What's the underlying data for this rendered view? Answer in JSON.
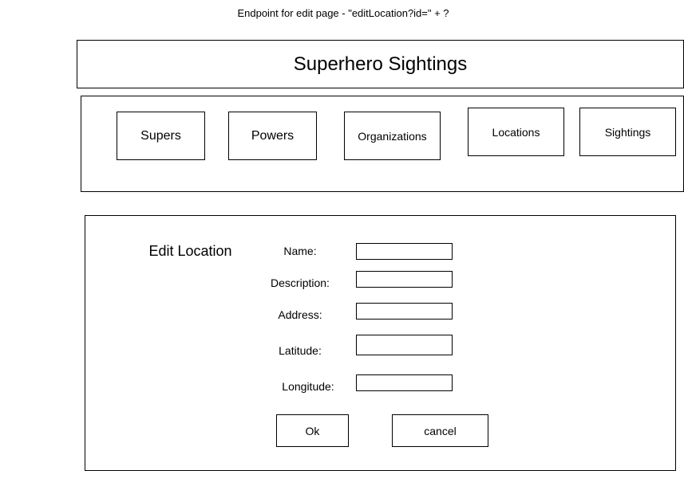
{
  "annotation": "Endpoint for  edit page - \"editLocation?id=\" + ?",
  "header": {
    "title": "Superhero Sightings"
  },
  "nav": {
    "items": [
      {
        "label": "Supers"
      },
      {
        "label": "Powers"
      },
      {
        "label": "Organizations"
      },
      {
        "label": "Locations"
      },
      {
        "label": "Sightings"
      }
    ]
  },
  "form": {
    "title": "Edit Location",
    "fields": [
      {
        "label": "Name:",
        "value": ""
      },
      {
        "label": "Description:",
        "value": ""
      },
      {
        "label": "Address:",
        "value": ""
      },
      {
        "label": "Latitude:",
        "value": ""
      },
      {
        "label": "Longitude:",
        "value": ""
      }
    ],
    "ok_label": "Ok",
    "cancel_label": "cancel"
  }
}
